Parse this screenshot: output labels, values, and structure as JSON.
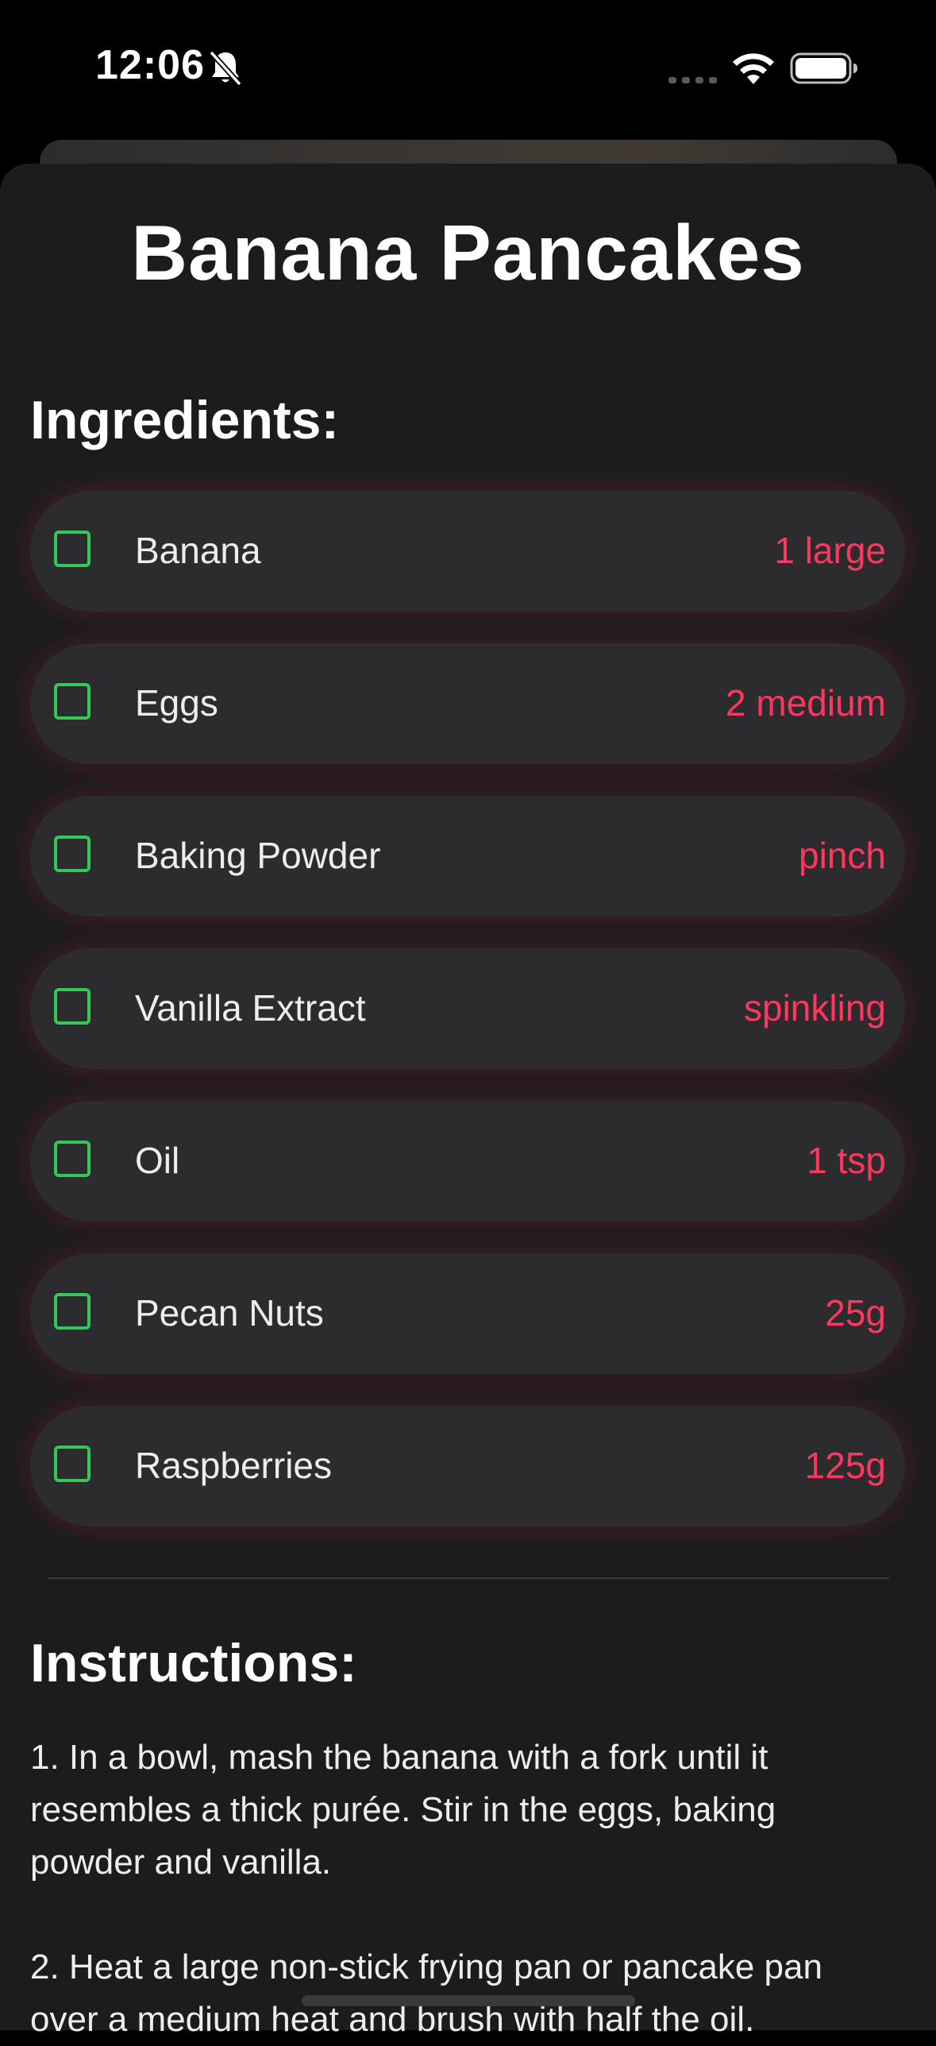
{
  "status_bar": {
    "time": "12:06"
  },
  "recipe": {
    "title": "Banana Pancakes",
    "ingredients_heading": "Ingredients:",
    "instructions_heading": "Instructions:",
    "ingredients": [
      {
        "name": "Banana",
        "qty": "1 large",
        "checked": false
      },
      {
        "name": "Eggs",
        "qty": "2 medium",
        "checked": false
      },
      {
        "name": "Baking Powder",
        "qty": "pinch",
        "checked": false
      },
      {
        "name": "Vanilla Extract",
        "qty": "spinkling",
        "checked": false
      },
      {
        "name": "Oil",
        "qty": "1 tsp",
        "checked": false
      },
      {
        "name": "Pecan Nuts",
        "qty": "25g",
        "checked": false
      },
      {
        "name": "Raspberries",
        "qty": "125g",
        "checked": false
      }
    ],
    "instructions": "1. In a bowl, mash the banana with a fork until it\nresembles a thick purée. Stir in the eggs, baking\npowder and vanilla.\n\n2. Heat a large non-stick frying pan or pancake pan\nover a medium heat and brush with half the oil."
  },
  "colors": {
    "accent_quantity": "#ff375f",
    "checkbox": "#34c759",
    "sheet_background": "#1c1c1e",
    "row_background": "#2c2c2e"
  },
  "icons": {
    "status": [
      "bell-slash-icon",
      "signal-icon",
      "wifi-icon",
      "battery-icon"
    ],
    "row": "checkbox-icon"
  }
}
